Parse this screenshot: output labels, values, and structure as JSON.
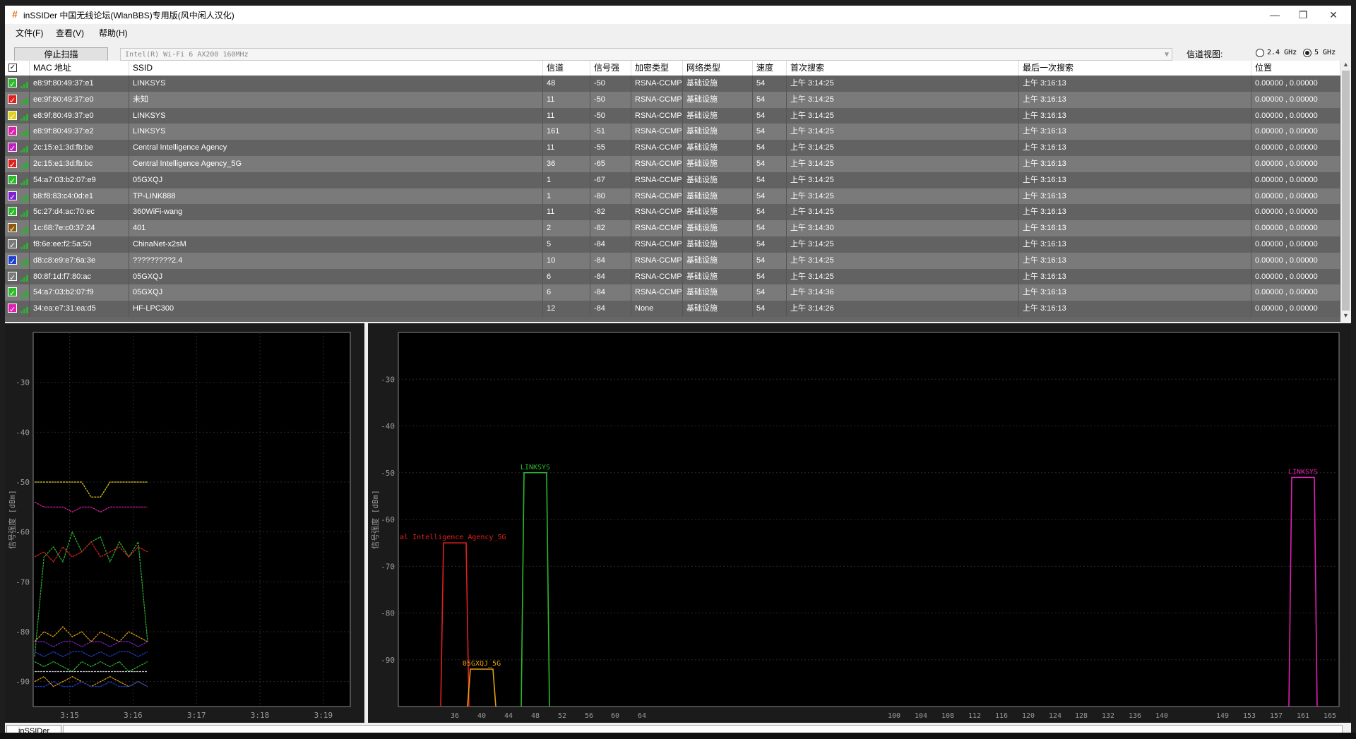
{
  "window": {
    "title": "inSSIDer 中国无线论坛(WlanBBS)专用版(风中闲人汉化)",
    "icon": "#",
    "controls": {
      "minimize": "—",
      "maximize": "❐",
      "close": "✕"
    }
  },
  "menu": [
    "文件(F)",
    "查看(V)",
    "帮助(H)"
  ],
  "toolbar": {
    "stop_scan": "停止扫描",
    "adapter": "Intel(R) Wi-Fi 6 AX200 160MHz",
    "channel_view_label": "信道视图:",
    "band_24": "2.4 GHz",
    "band_5": "5 GHz",
    "selected_band": "5 GHz"
  },
  "table": {
    "columns": [
      "",
      "MAC 地址",
      "SSID",
      "信道",
      "信号强",
      "加密类型",
      "网络类型",
      "速度",
      "首次搜索",
      "最后一次搜索",
      "位置"
    ],
    "rows": [
      {
        "color": "#2db82d",
        "mac": "e8:9f:80:49:37:e1",
        "ssid": "LINKSYS",
        "channel": "48",
        "rssi": "-50",
        "enc": "RSNA-CCMP",
        "net": "基础设施",
        "speed": "54",
        "first": "上午 3:14:25",
        "last": "上午 3:16:13",
        "pos": "0.00000 , 0.00000"
      },
      {
        "color": "#e02020",
        "mac": "ee:9f:80:49:37:e0",
        "ssid": "未知",
        "channel": "11",
        "rssi": "-50",
        "enc": "RSNA-CCMP",
        "net": "基础设施",
        "speed": "54",
        "first": "上午 3:14:25",
        "last": "上午 3:16:13",
        "pos": "0.00000 , 0.00000"
      },
      {
        "color": "#e0d020",
        "mac": "e8:9f:80:49:37:e0",
        "ssid": "LINKSYS",
        "channel": "11",
        "rssi": "-50",
        "enc": "RSNA-CCMP",
        "net": "基础设施",
        "speed": "54",
        "first": "上午 3:14:25",
        "last": "上午 3:16:13",
        "pos": "0.00000 , 0.00000"
      },
      {
        "color": "#e020b0",
        "mac": "e8:9f:80:49:37:e2",
        "ssid": "LINKSYS",
        "channel": "161",
        "rssi": "-51",
        "enc": "RSNA-CCMP",
        "net": "基础设施",
        "speed": "54",
        "first": "上午 3:14:25",
        "last": "上午 3:16:13",
        "pos": "0.00000 , 0.00000"
      },
      {
        "color": "#c020c0",
        "mac": "2c:15:e1:3d:fb:be",
        "ssid": "Central Intelligence Agency",
        "channel": "11",
        "rssi": "-55",
        "enc": "RSNA-CCMP",
        "net": "基础设施",
        "speed": "54",
        "first": "上午 3:14:25",
        "last": "上午 3:16:13",
        "pos": "0.00000 , 0.00000"
      },
      {
        "color": "#e02020",
        "mac": "2c:15:e1:3d:fb:bc",
        "ssid": "Central Intelligence Agency_5G",
        "channel": "36",
        "rssi": "-65",
        "enc": "RSNA-CCMP",
        "net": "基础设施",
        "speed": "54",
        "first": "上午 3:14:25",
        "last": "上午 3:16:13",
        "pos": "0.00000 , 0.00000"
      },
      {
        "color": "#2db82d",
        "mac": "54:a7:03:b2:07:e9",
        "ssid": "05GXQJ",
        "channel": "1",
        "rssi": "-67",
        "enc": "RSNA-CCMP",
        "net": "基础设施",
        "speed": "54",
        "first": "上午 3:14:25",
        "last": "上午 3:16:13",
        "pos": "0.00000 , 0.00000"
      },
      {
        "color": "#8020d0",
        "mac": "b8:f8:83:c4:0d:e1",
        "ssid": "TP-LINK888",
        "channel": "1",
        "rssi": "-80",
        "enc": "RSNA-CCMP",
        "net": "基础设施",
        "speed": "54",
        "first": "上午 3:14:25",
        "last": "上午 3:16:13",
        "pos": "0.00000 , 0.00000"
      },
      {
        "color": "#2db82d",
        "mac": "5c:27:d4:ac:70:ec",
        "ssid": "360WiFi-wang",
        "channel": "11",
        "rssi": "-82",
        "enc": "RSNA-CCMP",
        "net": "基础设施",
        "speed": "54",
        "first": "上午 3:14:25",
        "last": "上午 3:16:13",
        "pos": "0.00000 , 0.00000"
      },
      {
        "color": "#8a5a10",
        "mac": "1c:68:7e:c0:37:24",
        "ssid": "401",
        "channel": "2",
        "rssi": "-82",
        "enc": "RSNA-CCMP",
        "net": "基础设施",
        "speed": "54",
        "first": "上午 3:14:30",
        "last": "上午 3:16:13",
        "pos": "0.00000 , 0.00000"
      },
      {
        "color": "#7a7a7a",
        "mac": "f8:6e:ee:f2:5a:50",
        "ssid": "ChinaNet-x2sM",
        "channel": "5",
        "rssi": "-84",
        "enc": "RSNA-CCMP",
        "net": "基础设施",
        "speed": "54",
        "first": "上午 3:14:25",
        "last": "上午 3:16:13",
        "pos": "0.00000 , 0.00000"
      },
      {
        "color": "#2040d0",
        "mac": "d8:c8:e9:e7:6a:3e",
        "ssid": "?????????2.4",
        "channel": "10",
        "rssi": "-84",
        "enc": "RSNA-CCMP",
        "net": "基础设施",
        "speed": "54",
        "first": "上午 3:14:25",
        "last": "上午 3:16:13",
        "pos": "0.00000 , 0.00000"
      },
      {
        "color": "#7a7a7a",
        "mac": "80:8f:1d:f7:80:ac",
        "ssid": "05GXQJ",
        "channel": "6",
        "rssi": "-84",
        "enc": "RSNA-CCMP",
        "net": "基础设施",
        "speed": "54",
        "first": "上午 3:14:25",
        "last": "上午 3:16:13",
        "pos": "0.00000 , 0.00000"
      },
      {
        "color": "#2db82d",
        "mac": "54:a7:03:b2:07:f9",
        "ssid": "05GXQJ",
        "channel": "6",
        "rssi": "-84",
        "enc": "RSNA-CCMP",
        "net": "基础设施",
        "speed": "54",
        "first": "上午 3:14:36",
        "last": "上午 3:16:13",
        "pos": "0.00000 , 0.00000"
      },
      {
        "color": "#e020b0",
        "mac": "34:ea:e7:31:ea:d5",
        "ssid": "HF-LPC300",
        "channel": "12",
        "rssi": "-84",
        "enc": "None",
        "net": "基础设施",
        "speed": "54",
        "first": "上午 3:14:26",
        "last": "上午 3:16:13",
        "pos": "0.00000 , 0.00000"
      }
    ]
  },
  "chart_data": [
    {
      "type": "line",
      "ylabel": "信号强度 [dBm]",
      "ylim": [
        -95,
        -20
      ],
      "yticks": [
        -30,
        -40,
        -50,
        -60,
        -70,
        -80,
        -90
      ],
      "xticks": [
        "3:15",
        "3:16",
        "3:17",
        "3:18",
        "3:19"
      ],
      "grid": true,
      "series": [
        {
          "color": "#e0d020",
          "values": [
            -50,
            -50,
            -50,
            -50,
            -50,
            -50,
            -53,
            -53,
            -50,
            -50,
            -50,
            -50,
            -50
          ]
        },
        {
          "color": "#e020b0",
          "values": [
            -54,
            -55,
            -55,
            -55,
            -56,
            -55,
            -55,
            -56,
            -55,
            -55,
            -55,
            -55,
            -55
          ]
        },
        {
          "color": "#2db82d",
          "values": [
            -85,
            -65,
            -63,
            -66,
            -60,
            -64,
            -62,
            -61,
            -66,
            -62,
            -65,
            -62,
            -82
          ]
        },
        {
          "color": "#e02020",
          "values": [
            -65,
            -64,
            -66,
            -63,
            -65,
            -64,
            -62,
            -65,
            -64,
            -63,
            -65,
            -63,
            -64
          ]
        },
        {
          "color": "#e6a010",
          "values": [
            -82,
            -80,
            -81,
            -79,
            -81,
            -80,
            -82,
            -80,
            -81,
            -82,
            -80,
            -81,
            -82
          ]
        },
        {
          "color": "#8020d0",
          "values": [
            -82,
            -82,
            -83,
            -82,
            -82,
            -83,
            -82,
            -82,
            -83,
            -82,
            -82,
            -83,
            -82
          ]
        },
        {
          "color": "#2040d0",
          "values": [
            -84,
            -85,
            -84,
            -85,
            -84,
            -84,
            -85,
            -84,
            -85,
            -84,
            -84,
            -85,
            -84
          ]
        },
        {
          "color": "#2db82d",
          "values": [
            -86,
            -87,
            -86,
            -87,
            -88,
            -86,
            -87,
            -86,
            -87,
            -86,
            -88,
            -87,
            -86
          ]
        },
        {
          "color": "#cccccc",
          "values": [
            -88,
            -88,
            -88,
            -88,
            -88,
            -88,
            -88,
            -88,
            -88,
            -88,
            -88,
            -88,
            -88
          ]
        },
        {
          "color": "#e6a010",
          "values": [
            -90,
            -89,
            -91,
            -90,
            -89,
            -90,
            -91,
            -90,
            -89,
            -90,
            -91,
            -90,
            -91
          ]
        },
        {
          "color": "#2040d0",
          "values": [
            -91,
            -91,
            -90,
            -91,
            -91,
            -90,
            -91,
            -91,
            -90,
            -91,
            -91,
            -90,
            -91
          ]
        }
      ]
    },
    {
      "type": "area",
      "ylabel": "信号强度 [dBm]",
      "ylim": [
        -100,
        -20
      ],
      "yticks": [
        -30,
        -40,
        -50,
        -60,
        -70,
        -80,
        -90
      ],
      "xticks": [
        "36",
        "40",
        "44",
        "48",
        "52",
        "56",
        "60",
        "64",
        "100",
        "104",
        "108",
        "112",
        "116",
        "120",
        "124",
        "128",
        "132",
        "136",
        "140",
        "149",
        "153",
        "157",
        "161",
        "165"
      ],
      "xlim": [
        30,
        168
      ],
      "grid": true,
      "series": [
        {
          "name": "al Intelligence Agency_5G",
          "color": "#e02020",
          "channel": 36,
          "rssi": -65
        },
        {
          "name": "05GXQJ_5G",
          "color": "#e6a010",
          "channel": 40,
          "rssi": -92
        },
        {
          "name": "LINKSYS",
          "color": "#2db82d",
          "channel": 48,
          "rssi": -50
        },
        {
          "name": "LINKSYS",
          "color": "#e020b0",
          "channel": 161,
          "rssi": -51
        }
      ]
    }
  ],
  "status": {
    "tab": "inSSIDer"
  }
}
